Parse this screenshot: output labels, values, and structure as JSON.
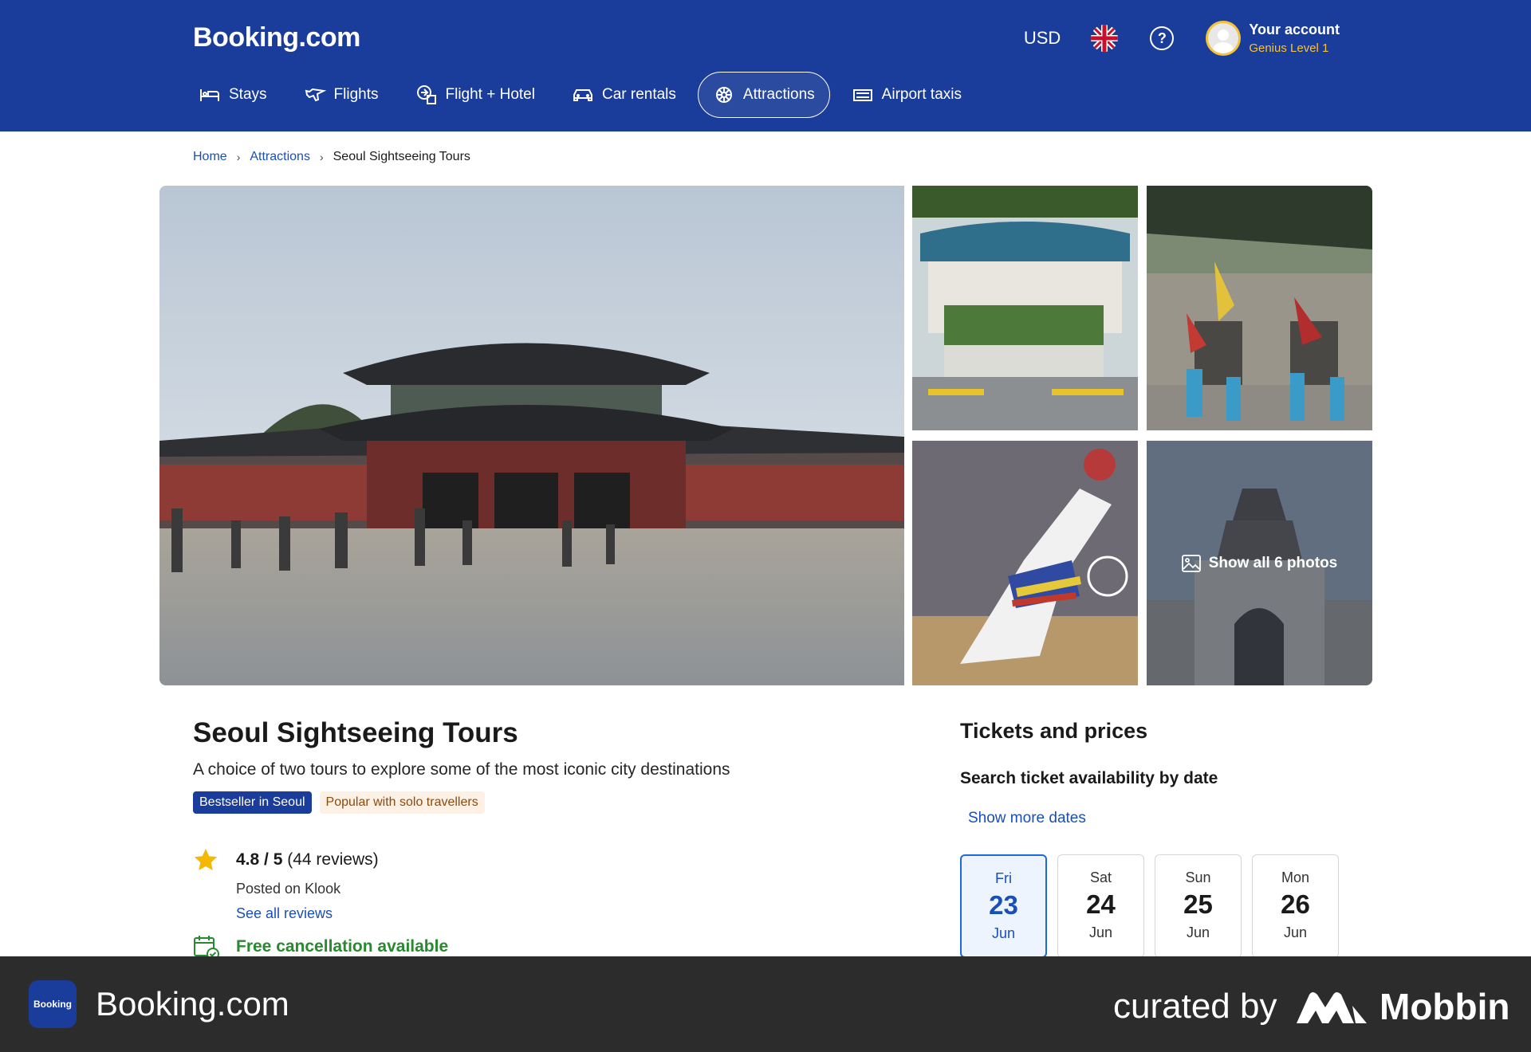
{
  "header": {
    "logo": "Booking.com",
    "currency": "USD",
    "account_name": "Your account",
    "account_level": "Genius Level 1",
    "nav": [
      {
        "label": "Stays",
        "icon": "bed-icon"
      },
      {
        "label": "Flights",
        "icon": "plane-icon"
      },
      {
        "label": "Flight + Hotel",
        "icon": "flight-hotel-icon"
      },
      {
        "label": "Car rentals",
        "icon": "car-icon"
      },
      {
        "label": "Attractions",
        "icon": "attractions-icon",
        "active": true
      },
      {
        "label": "Airport taxis",
        "icon": "taxi-icon"
      }
    ]
  },
  "breadcrumb": [
    "Home",
    "Attractions",
    "Seoul Sightseeing Tours"
  ],
  "gallery": {
    "show_all_label": "Show all 6 photos"
  },
  "attraction": {
    "title": "Seoul Sightseeing Tours",
    "subtitle": "A choice of two tours to explore some of the most iconic city destinations",
    "badge_bestseller": "Bestseller in Seoul",
    "badge_popular": "Popular with solo travellers",
    "rating": "4.8 / 5",
    "reviews": "(44 reviews)",
    "posted": "Posted on Klook",
    "see_all_reviews": "See all reviews",
    "free_cancellation": "Free cancellation available"
  },
  "tickets": {
    "title": "Tickets and prices",
    "search_label": "Search ticket availability by date",
    "show_more_dates": "Show more dates",
    "dates": [
      {
        "weekday": "Fri",
        "day": "23",
        "month": "Jun",
        "selected": true
      },
      {
        "weekday": "Sat",
        "day": "24",
        "month": "Jun"
      },
      {
        "weekday": "Sun",
        "day": "25",
        "month": "Jun"
      },
      {
        "weekday": "Mon",
        "day": "26",
        "month": "Jun"
      }
    ]
  },
  "footer": {
    "app_icon_text": "Booking",
    "app_name": "Booking.com",
    "curated_by": "curated by",
    "brand": "Mobbin"
  },
  "colors": {
    "header_bg": "#1a3c9a",
    "link": "#1a4fb5",
    "genius_gold": "#f5c23a",
    "success_green": "#268a2e",
    "footer_bg": "#2c2c2c"
  }
}
